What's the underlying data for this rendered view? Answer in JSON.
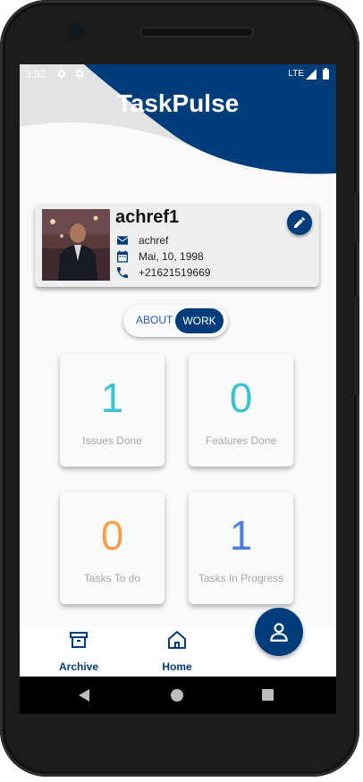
{
  "status_bar": {
    "time": "3:32",
    "network": "LTE"
  },
  "app": {
    "title": "TaskPulse"
  },
  "profile": {
    "name": "achref1",
    "username": "achref",
    "birthdate": "Mai, 10, 1998",
    "phone": "+21621519669"
  },
  "toggle": {
    "about_label": "ABOUT",
    "work_label": "WORK",
    "selected": "WORK"
  },
  "stats": [
    {
      "value": "1",
      "label": "Issues Done",
      "color": "#3cc3d3"
    },
    {
      "value": "0",
      "label": "Features Done",
      "color": "#3cc3d3"
    },
    {
      "value": "0",
      "label": "Tasks  To do",
      "color": "#f5a04a"
    },
    {
      "value": "1",
      "label": "Tasks In Progress",
      "color": "#4d7fe6"
    }
  ],
  "bottom_nav": {
    "items": [
      {
        "label": "Archive",
        "icon": "archive-icon"
      },
      {
        "label": "Home",
        "icon": "home-icon"
      }
    ],
    "fab_icon": "person-icon"
  },
  "colors": {
    "primary": "#003d7a",
    "wave_light": "#e3e3e3",
    "card_bg": "#eeeeee"
  }
}
